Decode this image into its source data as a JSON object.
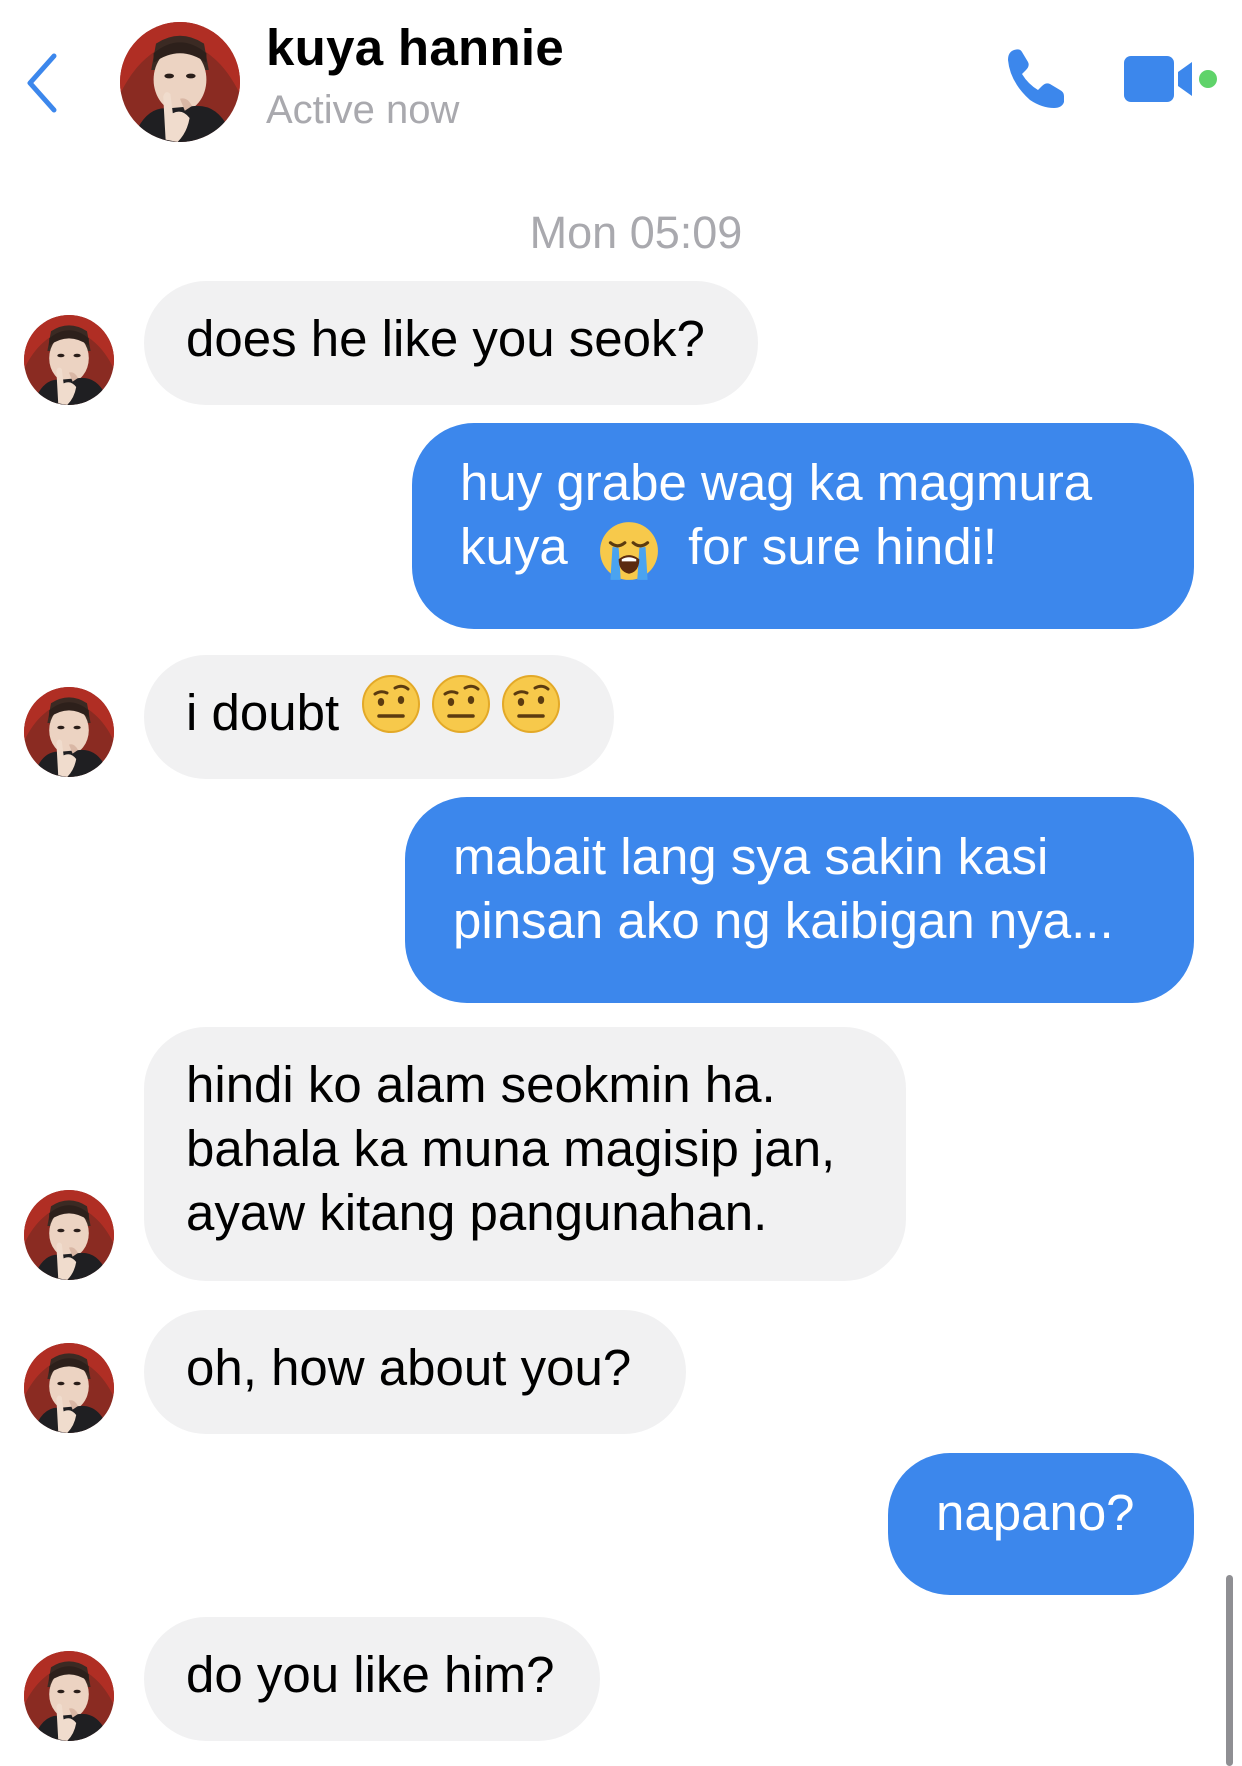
{
  "header": {
    "contact_name": "kuya hannie",
    "status": "Active now",
    "back_icon": "chevron-left-icon",
    "call_icon": "phone-icon",
    "video_icon": "video-camera-icon",
    "online_indicator_color": "#5fd36a",
    "accent_color": "#3c87ec"
  },
  "conversation": {
    "timestamp": "Mon 05:09",
    "messages": [
      {
        "direction": "incoming",
        "text": "does he like you seok?"
      },
      {
        "direction": "outgoing",
        "lines": [
          "huy grabe wag ka magmura",
          "kuya",
          "for sure hindi!"
        ],
        "emoji": "loudly-crying-face"
      },
      {
        "direction": "incoming",
        "text": "i doubt",
        "emoji": [
          "face-with-raised-eyebrow",
          "face-with-raised-eyebrow",
          "face-with-raised-eyebrow"
        ]
      },
      {
        "direction": "outgoing",
        "lines": [
          "mabait lang sya sakin kasi",
          "pinsan ako ng kaibigan nya..."
        ]
      },
      {
        "direction": "incoming",
        "lines": [
          "hindi ko alam seokmin ha.",
          "bahala ka muna magisip jan,",
          "ayaw kitang pangunahan."
        ]
      },
      {
        "direction": "incoming",
        "text": "oh, how about you?"
      },
      {
        "direction": "outgoing",
        "text": "napano?"
      },
      {
        "direction": "incoming",
        "text": "do you like him?"
      }
    ]
  },
  "colors": {
    "incoming_bubble": "#f1f1f2",
    "outgoing_bubble": "#3c87ec",
    "secondary_text": "#a9a9ae"
  }
}
